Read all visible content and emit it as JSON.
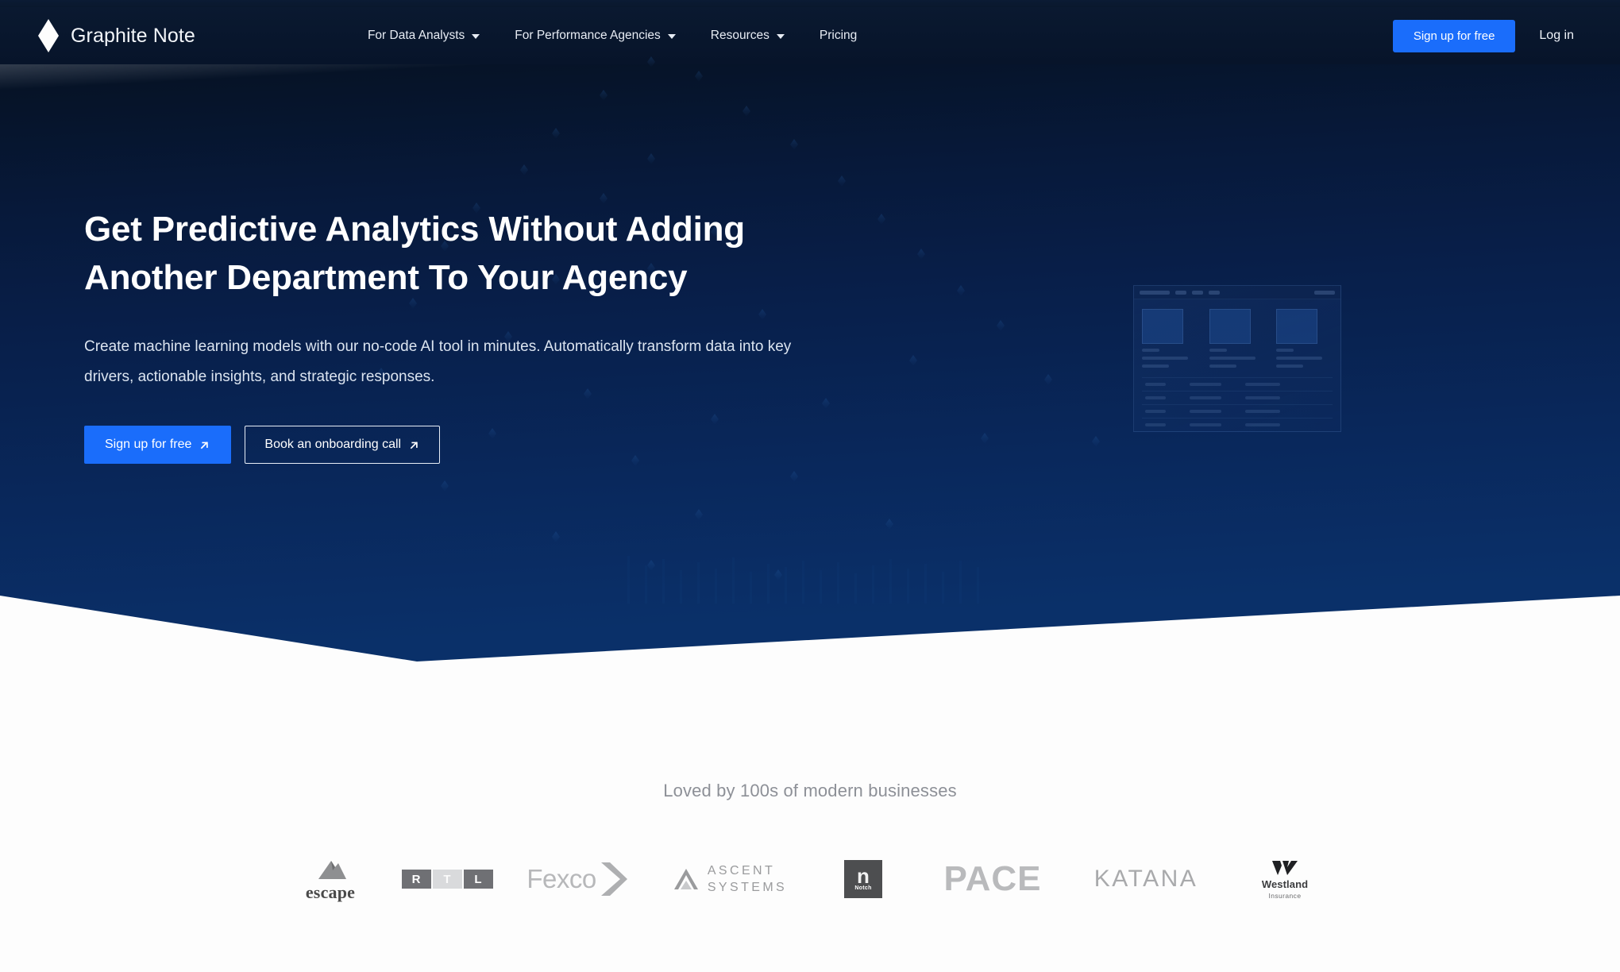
{
  "brand": {
    "name": "Graphite Note",
    "logo_icon": "diamond-icon"
  },
  "nav": {
    "items": [
      {
        "label": "For Data Analysts",
        "has_dropdown": true,
        "icon": "chevron-down-icon"
      },
      {
        "label": "For Performance Agencies",
        "has_dropdown": true,
        "icon": "chevron-down-icon"
      },
      {
        "label": "Resources",
        "has_dropdown": true,
        "icon": "chevron-down-icon"
      },
      {
        "label": "Pricing",
        "has_dropdown": false,
        "icon": ""
      }
    ],
    "signup_label": "Sign up for free",
    "login_label": "Log in"
  },
  "hero": {
    "title": "Get Predictive Analytics Without Adding Another Department To Your Agency",
    "subtitle": "Create machine learning models with our no-code AI tool in minutes. Automatically transform data into key drivers, actionable insights, and strategic responses.",
    "primary_cta": "Sign up for free",
    "primary_cta_icon": "arrow-up-right-icon",
    "secondary_cta": "Book an onboarding call",
    "secondary_cta_icon": "arrow-up-right-icon",
    "mockup_alt": "product-dashboard-preview"
  },
  "social_proof": {
    "heading": "Loved by 100s of modern businesses",
    "logos": [
      {
        "name": "escape",
        "icon": "mountain-icon"
      },
      {
        "name": "RTL",
        "letters": [
          "R",
          "T",
          "L"
        ]
      },
      {
        "name": "Fexco",
        "icon": "chevron-right-icon"
      },
      {
        "name": "ASCENT SYSTEMS",
        "line1": "ASCENT",
        "line2": "SYSTEMS",
        "icon": "triangle-icon"
      },
      {
        "name": "Notch",
        "letter": "n"
      },
      {
        "name": "PACE"
      },
      {
        "name": "KATANA"
      },
      {
        "name": "Westland Insurance",
        "line1": "Westland",
        "line2": "Insurance",
        "icon": "w-mark-icon"
      }
    ]
  },
  "colors": {
    "accent_blue": "#1a6dfb",
    "hero_top": "#040d1b",
    "hero_bottom": "#0a3169",
    "page_background": "#fdfdfd",
    "muted_text": "#8d9097"
  }
}
